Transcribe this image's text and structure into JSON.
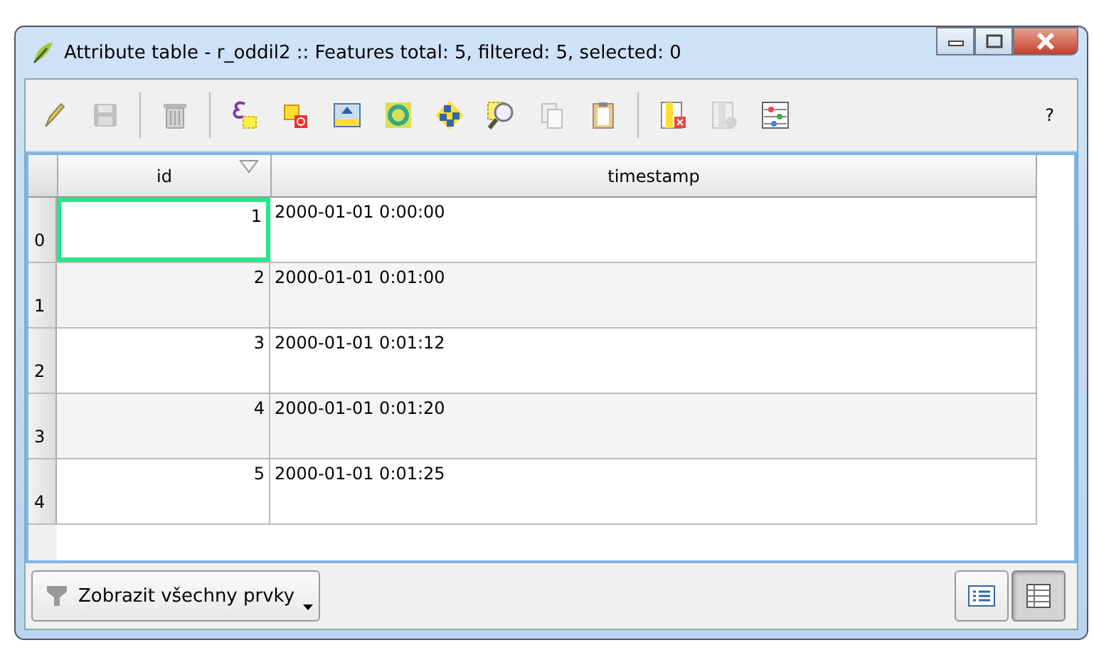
{
  "window": {
    "title": "Attribute table - r_oddil2 :: Features total: 5, filtered: 5, selected: 0"
  },
  "toolbar": {
    "tools": [
      {
        "kind": "pencil",
        "disabled": false
      },
      {
        "kind": "save",
        "disabled": true
      },
      {
        "kind": "separator"
      },
      {
        "kind": "trash",
        "disabled": true
      },
      {
        "kind": "separator"
      },
      {
        "kind": "expression",
        "disabled": false
      },
      {
        "kind": "deselect",
        "disabled": false
      },
      {
        "kind": "move-top",
        "disabled": false
      },
      {
        "kind": "invert",
        "disabled": false
      },
      {
        "kind": "pan",
        "disabled": false
      },
      {
        "kind": "zoom",
        "disabled": false
      },
      {
        "kind": "copy",
        "disabled": true
      },
      {
        "kind": "paste",
        "disabled": false
      },
      {
        "kind": "separator"
      },
      {
        "kind": "delete-column",
        "disabled": false
      },
      {
        "kind": "new-column",
        "disabled": true
      },
      {
        "kind": "calculator",
        "disabled": false
      }
    ],
    "help": "?"
  },
  "table": {
    "columns": [
      "id",
      "timestamp"
    ],
    "rows": [
      {
        "header": "0",
        "id": "1",
        "timestamp": "2000-01-01 0:00:00",
        "current": true
      },
      {
        "header": "1",
        "id": "2",
        "timestamp": "2000-01-01 0:01:00",
        "current": false
      },
      {
        "header": "2",
        "id": "3",
        "timestamp": "2000-01-01 0:01:12",
        "current": false
      },
      {
        "header": "3",
        "id": "4",
        "timestamp": "2000-01-01 0:01:20",
        "current": false
      },
      {
        "header": "4",
        "id": "5",
        "timestamp": "2000-01-01 0:01:25",
        "current": false
      }
    ]
  },
  "bottom": {
    "filter_button": "Zobrazit všechny prvky",
    "views": [
      {
        "kind": "form",
        "selected": false
      },
      {
        "kind": "table",
        "selected": true
      }
    ]
  }
}
